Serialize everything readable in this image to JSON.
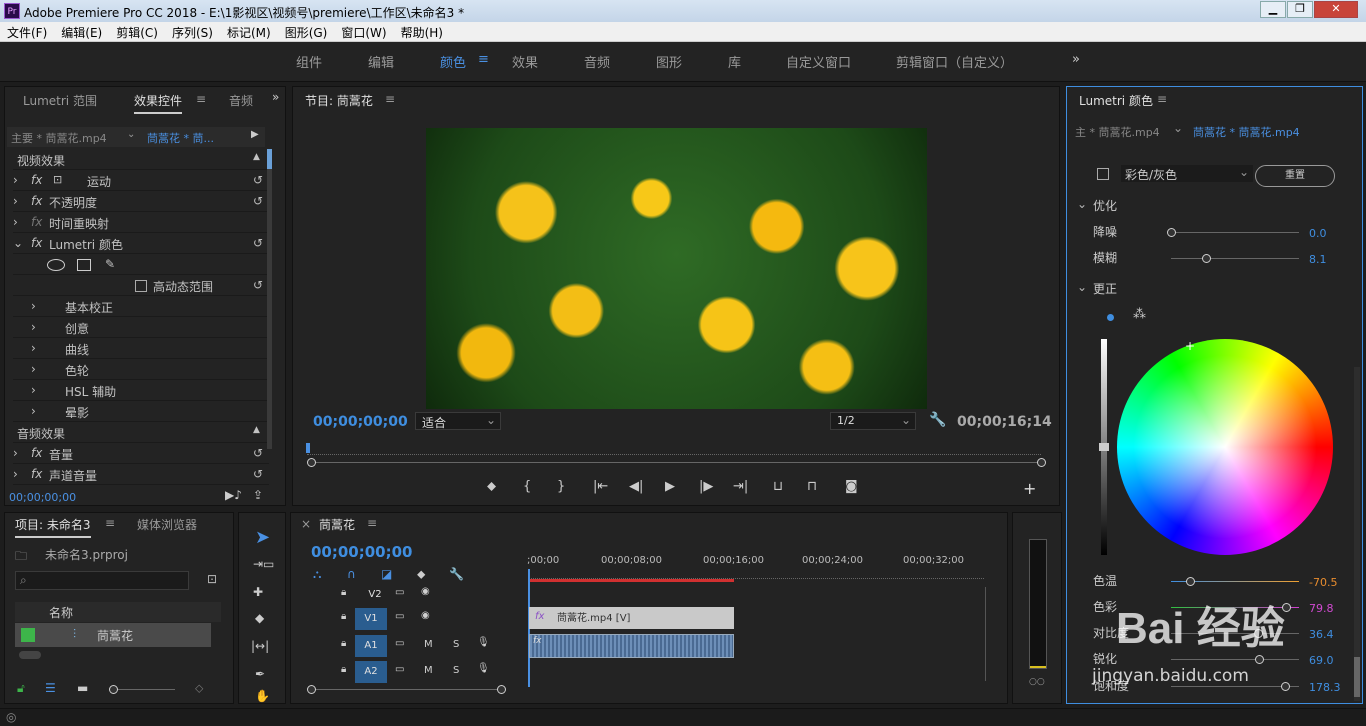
{
  "app": {
    "title": "Adobe Premiere Pro CC 2018 - E:\\1影视区\\视频号\\premiere\\工作区\\未命名3 *",
    "icon": "Pr"
  },
  "menu": [
    "文件(F)",
    "编辑(E)",
    "剪辑(C)",
    "序列(S)",
    "标记(M)",
    "图形(G)",
    "窗口(W)",
    "帮助(H)"
  ],
  "workspaces": [
    "组件",
    "编辑",
    "颜色",
    "效果",
    "音频",
    "图形",
    "库",
    "自定义窗口",
    "剪辑窗口（自定义）"
  ],
  "effects_panel": {
    "tabs": [
      "Lumetri 范围",
      "效果控件",
      "音频"
    ],
    "master": "主要 * 茼蒿花.mp4",
    "clip": "茼蒿花 * 茼...",
    "video_header": "视频效果",
    "audio_header": "音频效果",
    "video_effects": [
      "运动",
      "不透明度",
      "时间重映射",
      "Lumetri 颜色"
    ],
    "hdr": "高动态范围",
    "lumetri_sub": [
      "基本校正",
      "创意",
      "曲线",
      "色轮",
      "HSL 辅助",
      "晕影"
    ],
    "audio_effects": [
      "音量",
      "声道音量"
    ],
    "timecode": "00;00;00;00"
  },
  "program": {
    "title": "节目: 茼蒿花",
    "timecode": "00;00;00;00",
    "fit": "适合",
    "ratio": "1/2",
    "duration": "00;00;16;14"
  },
  "project": {
    "tabs": [
      "项目: 未命名3",
      "媒体浏览器"
    ],
    "file": "未命名3.prproj",
    "col": "名称",
    "item": "茼蒿花"
  },
  "timeline": {
    "title": "茼蒿花",
    "timecode": "00;00;00;00",
    "ruler": [
      ";00;00",
      "00;00;08;00",
      "00;00;16;00",
      "00;00;24;00",
      "00;00;32;00"
    ],
    "tracks": [
      "V2",
      "V1",
      "A1",
      "A2"
    ],
    "clip_v": "茼蒿花.mp4 [V]",
    "m": "M",
    "s": "S"
  },
  "lumetri": {
    "title": "Lumetri 颜色",
    "master": "主 * 茼蒿花.mp4",
    "clip": "茼蒿花 * 茼蒿花.mp4",
    "bw": "彩色/灰色",
    "reset": "重置",
    "optimize": "优化",
    "noise": "降噪",
    "noise_v": "0.0",
    "blur": "模糊",
    "blur_v": "8.1",
    "correct": "更正",
    "temp": "色温",
    "temp_v": "-70.5",
    "tint": "色彩",
    "tint_v": "79.8",
    "contrast": "对比度",
    "contrast_v": "36.4",
    "sharpen": "锐化",
    "sharpen_v": "69.0",
    "sat": "饱和度",
    "sat_v": "178.3"
  },
  "watermark": {
    "brand": "Bai 经验",
    "url": "jingyan.baidu.com"
  },
  "colors": {
    "accent": "#3f8ee0",
    "panel": "#232323",
    "bg": "#1d1d1d"
  }
}
